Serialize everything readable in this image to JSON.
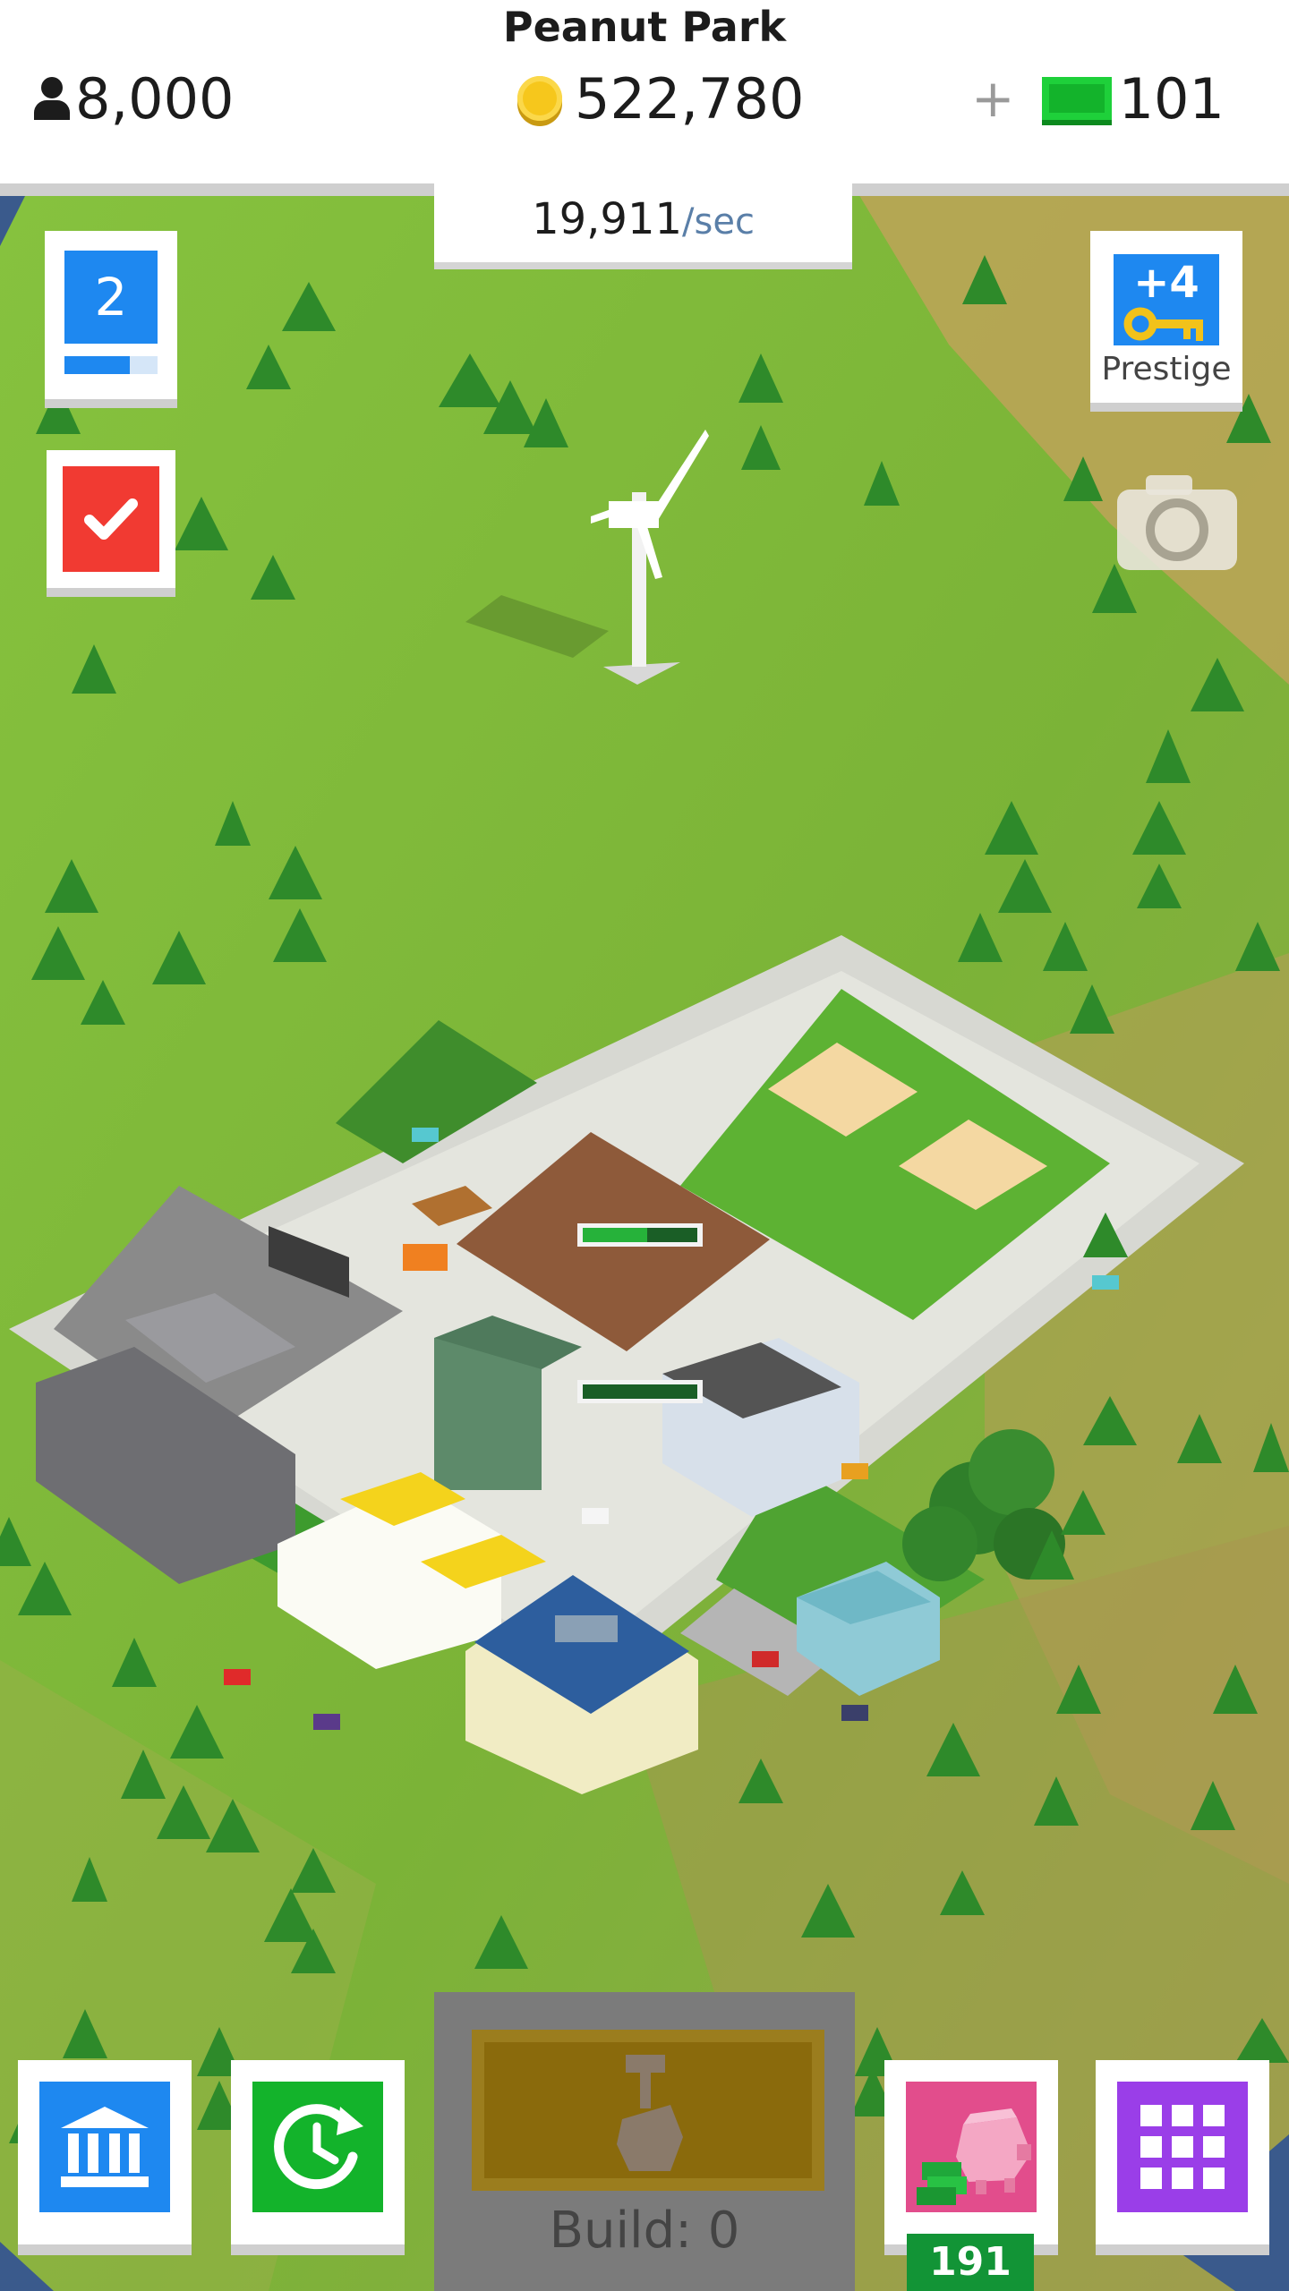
{
  "header": {
    "city_name": "Peanut Park",
    "population": "8,000",
    "coins": "522,780",
    "cash_plus": "+",
    "cash": "101",
    "rate_value": "19,911",
    "rate_unit": "/sec"
  },
  "level": {
    "value": "2",
    "progress": 0.7
  },
  "prestige": {
    "count": "+4",
    "label": "Prestige"
  },
  "bottom": {
    "build_label": "Build: 0",
    "piggy_count": "191"
  },
  "icons": {
    "population": "person-icon",
    "coins": "coin-icon",
    "cash": "cash-bill-icon",
    "quest": "checkmark-icon",
    "prestige": "key-icon",
    "camera": "camera-icon",
    "bank": "bank-icon",
    "time": "time-warp-icon",
    "build": "build-hammer-icon",
    "piggy": "piggy-bank-icon",
    "menu": "grid-menu-icon"
  },
  "colors": {
    "blue": "#1e88f0",
    "green": "#13b32b",
    "red": "#f13a32",
    "purple": "#9a3ee8",
    "pink": "#e24d8c",
    "grass": "#7db83a"
  }
}
